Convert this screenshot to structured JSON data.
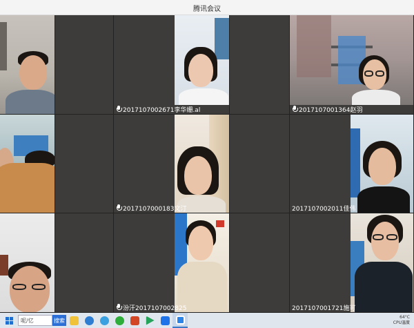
{
  "window": {
    "title": "腾讯会议"
  },
  "participants": [
    {
      "id": "p1",
      "name": ""
    },
    {
      "id": "p2",
      "name": "2017107002671李华姗.al"
    },
    {
      "id": "p3",
      "name": "2017107001364赵羽"
    },
    {
      "id": "p4",
      "name": ""
    },
    {
      "id": "p5",
      "name": "2017107000183文汀"
    },
    {
      "id": "p6",
      "name": "2017107002011佳伟"
    },
    {
      "id": "p7",
      "name": ""
    },
    {
      "id": "p8",
      "name": "汾汗2017107002825"
    },
    {
      "id": "p9",
      "name": "2017107001721施可"
    }
  ],
  "taskbar": {
    "search_text": "呢/亿",
    "search_button": "搜索",
    "tray_line1": "64°C",
    "tray_line2": "CPU温度"
  },
  "colors": {
    "taskbar_bg": "#dfe6ee",
    "grid_bg": "#3b3a38",
    "accent": "#2b6fd6"
  }
}
